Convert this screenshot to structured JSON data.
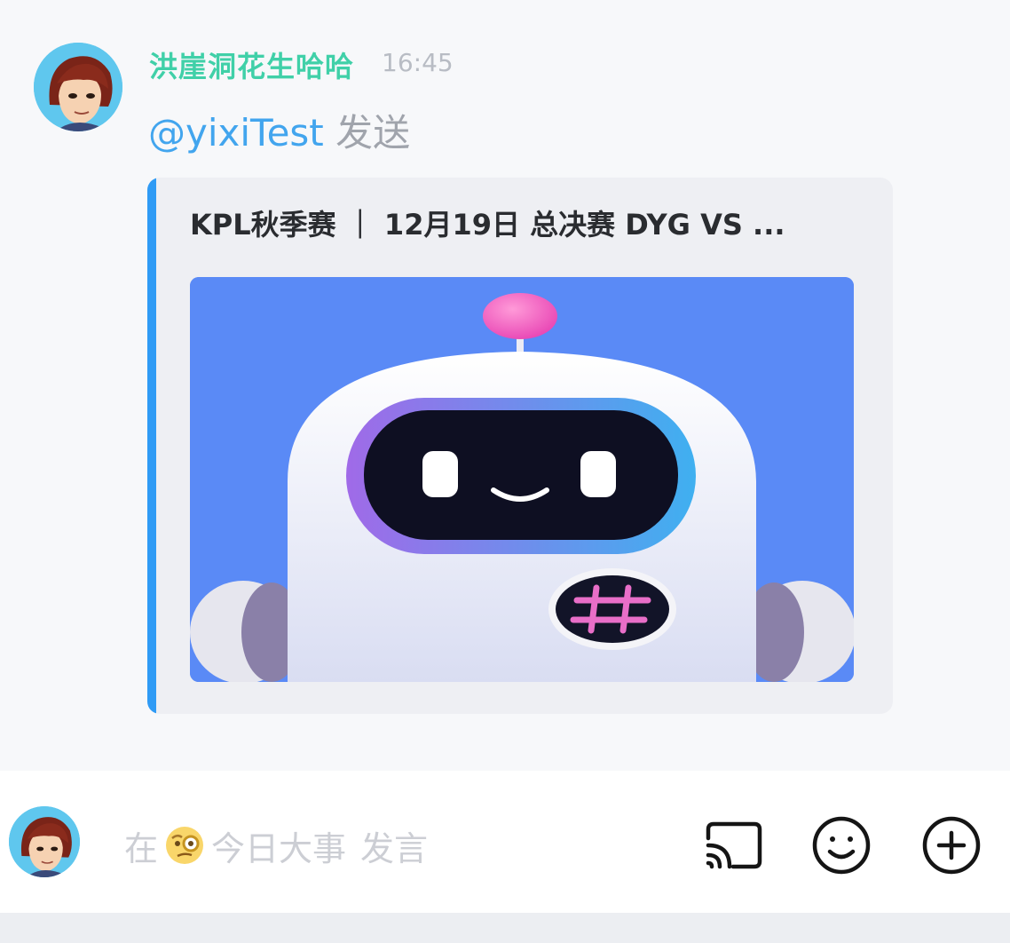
{
  "message": {
    "sender_name": "洪崖洞花生哈哈",
    "time": "16:45",
    "mention": "@yixiTest",
    "text": " 发送"
  },
  "link_card": {
    "title": "KPL秋季赛 ｜ 12月19日 总决赛 DYG VS ...",
    "thumbnail": "robot-mascot-image",
    "accent_color": "#2f9bf5"
  },
  "input": {
    "placeholder_prefix": "在",
    "channel_name": "今日大事",
    "placeholder_suffix": "发言",
    "channel_icon": "monocle-face-emoji"
  },
  "toolbar": {
    "icons": [
      "cast-icon",
      "emoji-icon",
      "plus-circle-icon"
    ]
  },
  "colors": {
    "sender": "#40d0a8",
    "mention": "#42a5ee",
    "card_bar": "#2f9bf5"
  }
}
